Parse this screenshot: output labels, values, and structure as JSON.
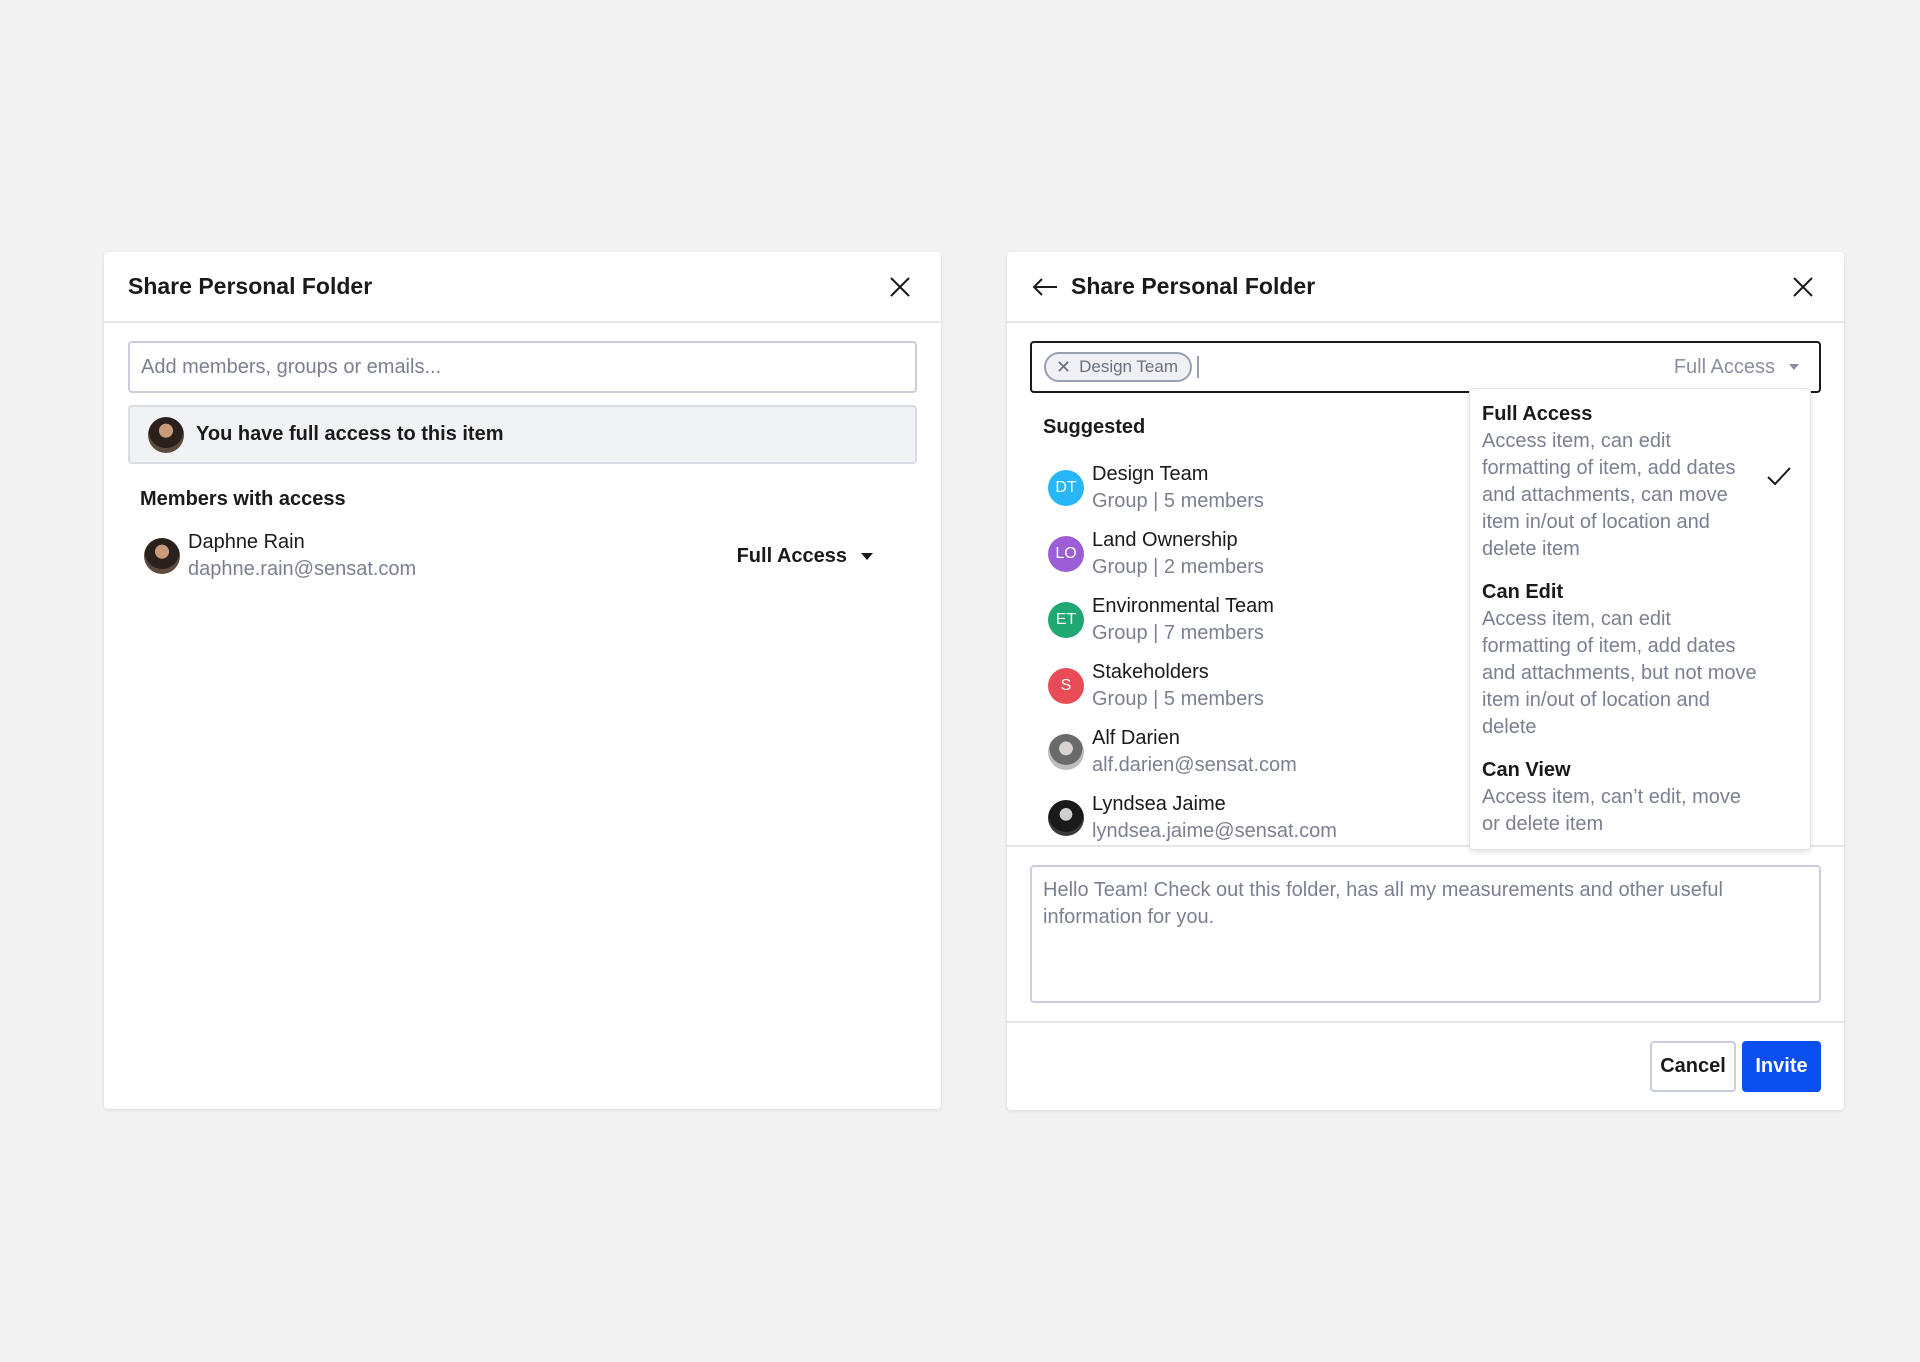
{
  "left_modal": {
    "title": "Share Personal Folder",
    "input_placeholder": "Add members, groups or emails...",
    "notice": "You have full access to this item",
    "members_label": "Members with access",
    "members": [
      {
        "name": "Daphne Rain",
        "email": "daphne.rain@sensat.com",
        "access": "Full Access"
      }
    ]
  },
  "right_modal": {
    "title": "Share Personal Folder",
    "chip_label": "Design Team",
    "permission_selected": "Full Access",
    "suggested_label": "Suggested",
    "suggested": [
      {
        "initials": "DT",
        "name": "Design Team",
        "sub": "Group | 5 members",
        "color": "#29b6f6"
      },
      {
        "initials": "LO",
        "name": "Land Ownership",
        "sub": "Group | 2 members",
        "color": "#9c5ed6"
      },
      {
        "initials": "ET",
        "name": "Environmental Team",
        "sub": "Group | 7 members",
        "color": "#1fa774"
      },
      {
        "initials": "S",
        "name": "Stakeholders",
        "sub": "Group | 5 members",
        "color": "#e84d57"
      },
      {
        "initials": "",
        "name": "Alf Darien",
        "sub": "alf.darien@sensat.com",
        "color": ""
      },
      {
        "initials": "",
        "name": "Lyndsea Jaime",
        "sub": "lyndsea.jaime@sensat.com",
        "color": ""
      }
    ],
    "permission_options": [
      {
        "title": "Full Access",
        "desc": "Access item, can edit formatting of item, add dates and attachments, can move item in/out of location and delete item",
        "selected": true
      },
      {
        "title": "Can Edit",
        "desc": "Access item, can edit formatting of item, add dates and attachments, but not move item in/out of location and delete",
        "selected": false
      },
      {
        "title": "Can View",
        "desc": "Access item, can’t edit, move or delete item",
        "selected": false
      }
    ],
    "message": "Hello Team! Check out this folder, has all my measurements and other useful information for you.",
    "cancel_label": "Cancel",
    "invite_label": "Invite"
  },
  "icons": {
    "close": "close-icon",
    "back": "arrow-left-icon",
    "check": "check-icon",
    "remove_chip": "x-icon"
  },
  "colors": {
    "primary": "#0b4ff0"
  }
}
